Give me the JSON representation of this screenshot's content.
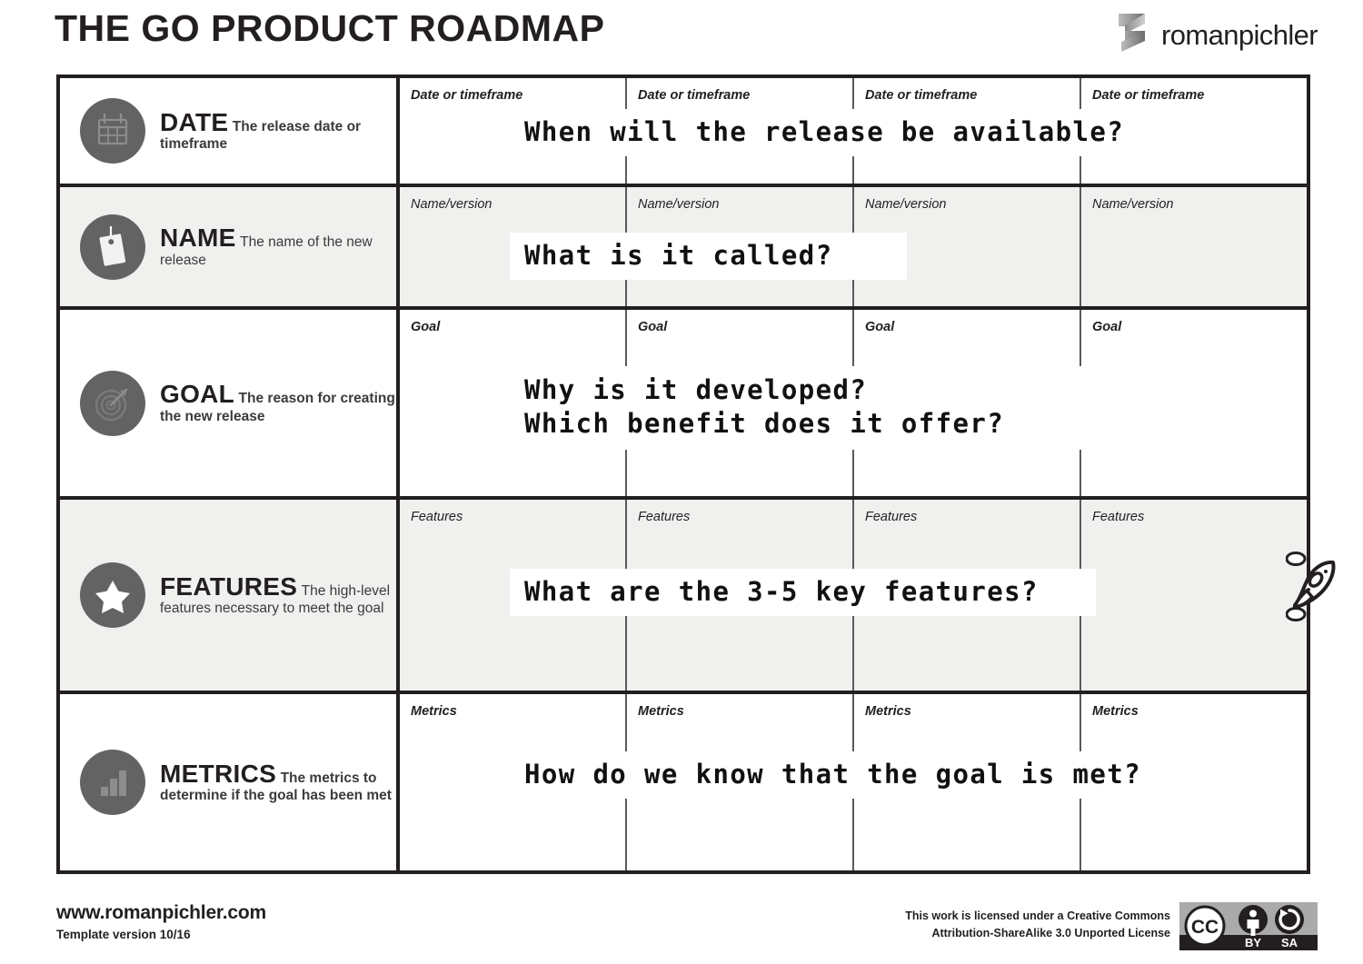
{
  "header": {
    "title": "THE GO PRODUCT ROADMAP",
    "brand": "romanpichler",
    "brand_icon": "zigzag-ribbon-logo-icon"
  },
  "columns": [
    {
      "index": 1
    },
    {
      "index": 2
    },
    {
      "index": 3
    },
    {
      "index": 4
    }
  ],
  "rows": [
    {
      "id": "date",
      "title": "DATE",
      "subtitle": "The release date or timeframe",
      "icon": "calendar-icon",
      "placeholder": "Date or timeframe",
      "shaded": false,
      "question": [
        "When will the release be available?"
      ]
    },
    {
      "id": "name",
      "title": "NAME",
      "subtitle": "The name of the new release",
      "icon": "tag-icon",
      "placeholder": "Name/version",
      "shaded": true,
      "question": [
        "What is it called?"
      ]
    },
    {
      "id": "goal",
      "title": "GOAL",
      "subtitle": "The reason for creating the new release",
      "icon": "target-icon",
      "placeholder": "Goal",
      "shaded": false,
      "question": [
        "Why is it developed?",
        "Which benefit does it offer?"
      ]
    },
    {
      "id": "features",
      "title": "FEATURES",
      "subtitle": "The high-level features necessary to meet the goal",
      "icon": "star-icon",
      "placeholder": "Features",
      "shaded": true,
      "question": [
        "What are the 3-5 key features?"
      ]
    },
    {
      "id": "metrics",
      "title": "METRICS",
      "subtitle": "The metrics to determine if the goal has been met",
      "icon": "bar-chart-icon",
      "placeholder": "Metrics",
      "shaded": false,
      "question": [
        "How do we know that the goal is met?"
      ]
    }
  ],
  "decoration": {
    "rocket_icon": "rocket-doodle-icon"
  },
  "footer": {
    "website": "www.romanpichler.com",
    "version": "Template version 10/16",
    "license_line1": "This work is licensed under a Creative Commons",
    "license_line2": "Attribution-ShareAlike 3.0 Unported License",
    "cc_badge": {
      "cc_label": "CC",
      "by_label": "BY",
      "sa_label": "SA"
    }
  },
  "colors": {
    "ink": "#231f20",
    "icon_circle": "#636363",
    "shaded_row": "#f0f0ee",
    "cell_divider": "#5a5a5a",
    "overlay_bg": "#ffffff"
  }
}
